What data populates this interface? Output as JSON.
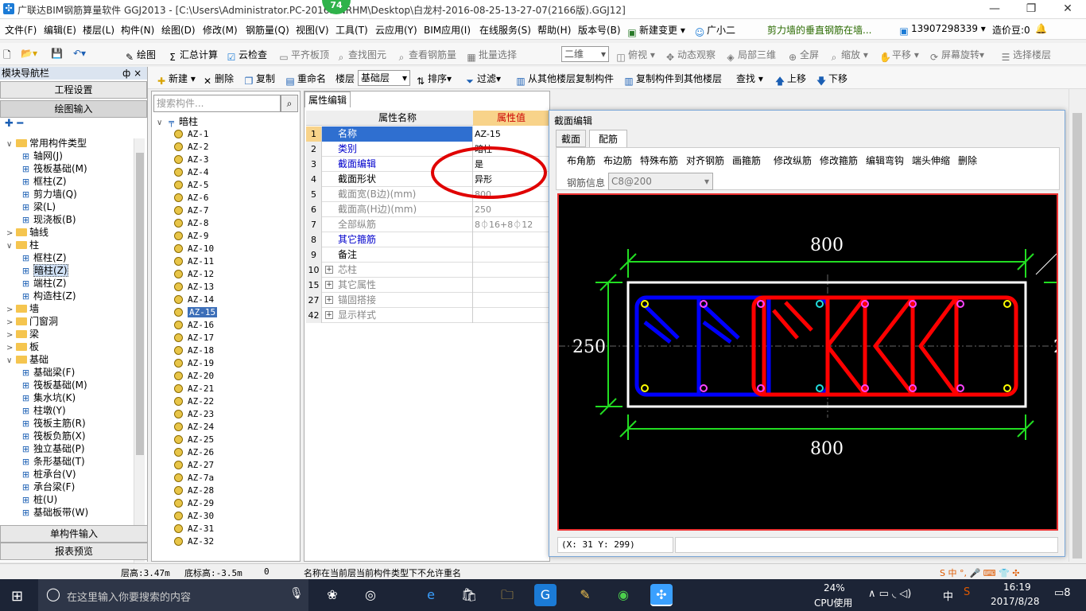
{
  "window": {
    "title": "广联达BIM钢筋算量软件 GGJ2013 - [C:\\Users\\Administrator.PC-2016...NRHM\\Desktop\\白龙村-2016-08-25-13-27-07(2166版).GGJ12]",
    "badge": "74",
    "minimize": "—",
    "restore": "❐",
    "close": "✕"
  },
  "menu": {
    "items": [
      "文件(F)",
      "编辑(E)",
      "楼层(L)",
      "构件(N)",
      "绘图(D)",
      "修改(M)",
      "钢筋量(Q)",
      "视图(V)",
      "工具(T)",
      "云应用(Y)",
      "BIM应用(I)",
      "在线服务(S)",
      "帮助(H)",
      "版本号(B)"
    ],
    "new_change": "新建变更",
    "guang_xiao_er": "广小二",
    "hint": "剪力墙的垂直钢筋在墙...",
    "phone": "13907298339",
    "price_coin": "造价豆:0"
  },
  "toolbar1": {
    "draw": "绘图",
    "sum": "汇总计算",
    "cloud_check": "云检查",
    "flat_top": "平齐板顶",
    "find_element": "查找图元",
    "view_rebar": "查看钢筋量",
    "batch_select": "批量选择",
    "view_mode": "二维",
    "top_view": "俯视",
    "dynamic_view": "动态观察",
    "local_3d": "局部三维",
    "fullscreen": "全屏",
    "zoom": "缩放",
    "pan": "平移",
    "rotate": "屏幕旋转",
    "select_floor": "选择楼层"
  },
  "toolbar2": {
    "new": "新建",
    "delete": "删除",
    "copy": "复制",
    "rename": "重命名",
    "floor_label": "楼层",
    "floor_value": "基础层",
    "sort": "排序",
    "filter": "过滤",
    "copy_from_other": "从其他楼层复制构件",
    "copy_to_other": "复制构件到其他楼层",
    "find": "查找",
    "move_up": "上移",
    "move_down": "下移"
  },
  "nav": {
    "header": "模块导航栏",
    "pin": "ф ×",
    "project_settings": "工程设置",
    "drawing_input": "绘图输入",
    "single_input": "单构件输入",
    "report_preview": "报表预览",
    "tree": [
      {
        "label": "常用构件类型",
        "level": 0,
        "folder": true,
        "exp": "∨"
      },
      {
        "label": "轴网(J)",
        "level": 1
      },
      {
        "label": "筏板基础(M)",
        "level": 1
      },
      {
        "label": "框柱(Z)",
        "level": 1
      },
      {
        "label": "剪力墙(Q)",
        "level": 1
      },
      {
        "label": "梁(L)",
        "level": 1
      },
      {
        "label": "现浇板(B)",
        "level": 1
      },
      {
        "label": "轴线",
        "level": 0,
        "folder": true,
        "exp": ">"
      },
      {
        "label": "柱",
        "level": 0,
        "folder": true,
        "exp": "∨"
      },
      {
        "label": "框柱(Z)",
        "level": 1
      },
      {
        "label": "暗柱(Z)",
        "level": 1,
        "selected": true
      },
      {
        "label": "端柱(Z)",
        "level": 1
      },
      {
        "label": "构造柱(Z)",
        "level": 1
      },
      {
        "label": "墙",
        "level": 0,
        "folder": true,
        "exp": ">"
      },
      {
        "label": "门窗洞",
        "level": 0,
        "folder": true,
        "exp": ">"
      },
      {
        "label": "梁",
        "level": 0,
        "folder": true,
        "exp": ">"
      },
      {
        "label": "板",
        "level": 0,
        "folder": true,
        "exp": ">"
      },
      {
        "label": "基础",
        "level": 0,
        "folder": true,
        "exp": "∨"
      },
      {
        "label": "基础梁(F)",
        "level": 1
      },
      {
        "label": "筏板基础(M)",
        "level": 1
      },
      {
        "label": "集水坑(K)",
        "level": 1
      },
      {
        "label": "柱墩(Y)",
        "level": 1
      },
      {
        "label": "筏板主筋(R)",
        "level": 1
      },
      {
        "label": "筏板负筋(X)",
        "level": 1
      },
      {
        "label": "独立基础(P)",
        "level": 1
      },
      {
        "label": "条形基础(T)",
        "level": 1
      },
      {
        "label": "桩承台(V)",
        "level": 1
      },
      {
        "label": "承台梁(F)",
        "level": 1
      },
      {
        "label": "桩(U)",
        "level": 1
      },
      {
        "label": "基础板带(W)",
        "level": 1
      }
    ]
  },
  "components": {
    "search_placeholder": "搜索构件...",
    "root": "暗柱",
    "items": [
      "AZ-1",
      "AZ-2",
      "AZ-3",
      "AZ-4",
      "AZ-5",
      "AZ-6",
      "AZ-7",
      "AZ-8",
      "AZ-9",
      "AZ-10",
      "AZ-11",
      "AZ-12",
      "AZ-13",
      "AZ-14",
      "AZ-15",
      "AZ-16",
      "AZ-17",
      "AZ-18",
      "AZ-19",
      "AZ-20",
      "AZ-21",
      "AZ-22",
      "AZ-23",
      "AZ-24",
      "AZ-25",
      "AZ-26",
      "AZ-27",
      "AZ-7a",
      "AZ-28",
      "AZ-29",
      "AZ-30",
      "AZ-31",
      "AZ-32"
    ],
    "selected": "AZ-15"
  },
  "properties": {
    "tab": "属性编辑",
    "col_name": "属性名称",
    "col_value": "属性值",
    "rows": [
      {
        "num": "1",
        "name": "名称",
        "value": "AZ-15",
        "style": "blue",
        "selected": true
      },
      {
        "num": "2",
        "name": "类别",
        "value": "暗柱",
        "style": "blue"
      },
      {
        "num": "3",
        "name": "截面编辑",
        "value": "是",
        "style": "blue"
      },
      {
        "num": "4",
        "name": "截面形状",
        "value": "异形",
        "style": "normal"
      },
      {
        "num": "5",
        "name": "截面宽(B边)(mm)",
        "value": "800",
        "style": "gray"
      },
      {
        "num": "6",
        "name": "截面高(H边)(mm)",
        "value": "250",
        "style": "gray"
      },
      {
        "num": "7",
        "name": "全部纵筋",
        "value": "8⏀16+8⏀12",
        "style": "gray"
      },
      {
        "num": "8",
        "name": "其它箍筋",
        "value": "",
        "style": "blue"
      },
      {
        "num": "9",
        "name": "备注",
        "value": "",
        "style": "normal"
      },
      {
        "num": "10",
        "name": "芯柱",
        "value": "",
        "style": "gray",
        "expand": true
      },
      {
        "num": "15",
        "name": "其它属性",
        "value": "",
        "style": "gray",
        "expand": true
      },
      {
        "num": "27",
        "name": "锚固搭接",
        "value": "",
        "style": "gray",
        "expand": true
      },
      {
        "num": "42",
        "name": "显示样式",
        "value": "",
        "style": "gray",
        "expand": true
      }
    ]
  },
  "section_editor": {
    "title": "截面编辑",
    "tab_section": "截面",
    "tab_rebar": "配筋",
    "tools": [
      "布角筋",
      "布边筋",
      "特殊布筋",
      "对齐钢筋",
      "画箍筋",
      "修改纵筋",
      "修改箍筋",
      "编辑弯钩",
      "端头伸缩",
      "删除"
    ],
    "rebar_info_label": "钢筋信息",
    "rebar_info_value": "C8@200",
    "dim_top": "800",
    "dim_bottom": "800",
    "dim_left": "250",
    "dim_right": "2",
    "coords": "(X: 31 Y: 299)"
  },
  "status": {
    "floor_height": "层高:3.47m",
    "base_height": "底标高:-3.5m",
    "zero": "0",
    "message": "名称在当前层当前构件类型下不允许重名"
  },
  "taskbar": {
    "search_placeholder": "在这里输入你要搜索的内容",
    "cpu_percent": "24%",
    "cpu_label": "CPU使用",
    "ime": "中",
    "time": "16:19",
    "date": "2017/8/28",
    "notif": "8"
  },
  "colors": {
    "accent": "#3d6fb8",
    "annotation_red": "#e00000",
    "canvas_bg": "#000000",
    "dim_green": "#22dd22",
    "rebar_blue": "#0000ff",
    "rebar_red": "#ff0000"
  }
}
